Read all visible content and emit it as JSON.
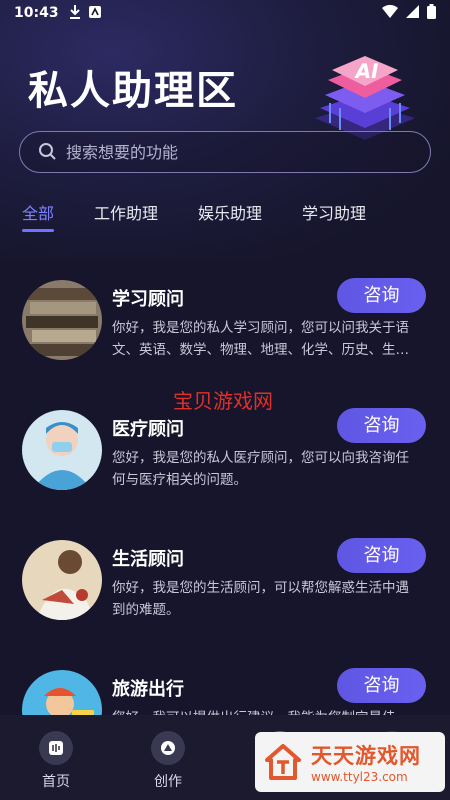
{
  "status_bar": {
    "time": "10:43"
  },
  "page": {
    "title": "私人助理区"
  },
  "ai_badge": {
    "text": "AI"
  },
  "search": {
    "placeholder": "搜索想要的功能"
  },
  "tabs": [
    {
      "label": "全部",
      "active": true
    },
    {
      "label": "工作助理",
      "active": false
    },
    {
      "label": "娱乐助理",
      "active": false
    },
    {
      "label": "学习助理",
      "active": false
    }
  ],
  "cards": [
    {
      "title": "学习顾问",
      "desc": "你好，我是您的私人学习顾问，您可以问我关于语文、英语、数学、物理、地理、化学、历史、生…",
      "button": "咨询"
    },
    {
      "title": "医疗顾问",
      "desc": "您好，我是您的私人医疗顾问，您可以向我咨询任何与医疗相关的问题。",
      "button": "咨询"
    },
    {
      "title": "生活顾问",
      "desc": "你好，我是您的生活顾问，可以帮您解惑生活中遇到的难题。",
      "button": "咨询"
    },
    {
      "title": "旅游出行",
      "desc": "您好，我可以提供出行建议，我能为您制定最佳的…",
      "button": "咨询"
    }
  ],
  "watermark_center": "宝贝游戏网",
  "bottom_nav": [
    {
      "label": "首页"
    },
    {
      "label": "创作"
    }
  ],
  "watermark_logo": {
    "title": "天天游戏网",
    "url": "www.ttyl23.com"
  },
  "colors": {
    "accent": "#6e74ff",
    "button": "#5f56e3",
    "background": "#16152b",
    "watermark_red": "#e0302a"
  }
}
